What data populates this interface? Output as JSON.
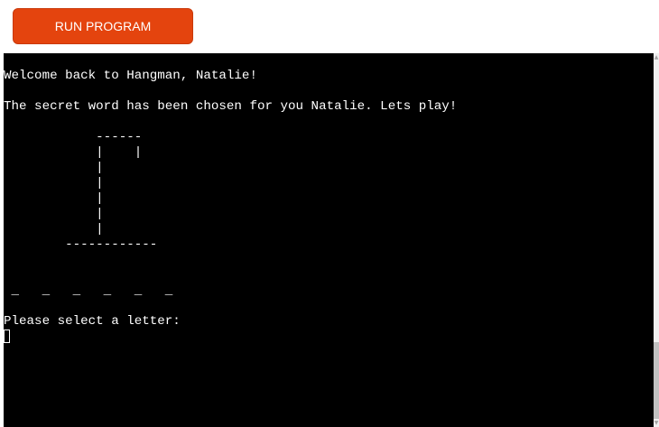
{
  "toolbar": {
    "run_label": "RUN PROGRAM",
    "run_color": "#e4440e"
  },
  "terminal": {
    "background": "#000000",
    "foreground": "#ffffff",
    "lines": [
      "Welcome back to Hangman, Natalie!",
      "",
      "The secret word has been chosen for you Natalie. Lets play!",
      "",
      "            ------",
      "            |    |",
      "            |",
      "            |",
      "            |",
      "            |",
      "            |",
      "        ------------",
      "",
      "",
      " _   _   _   _   _   _",
      "",
      "Please select a letter:"
    ],
    "cursor_icon": "text-cursor-icon"
  },
  "scrollbar": {
    "up_icon": "scroll-up-arrow-icon",
    "down_icon": "scroll-down-arrow-icon"
  }
}
